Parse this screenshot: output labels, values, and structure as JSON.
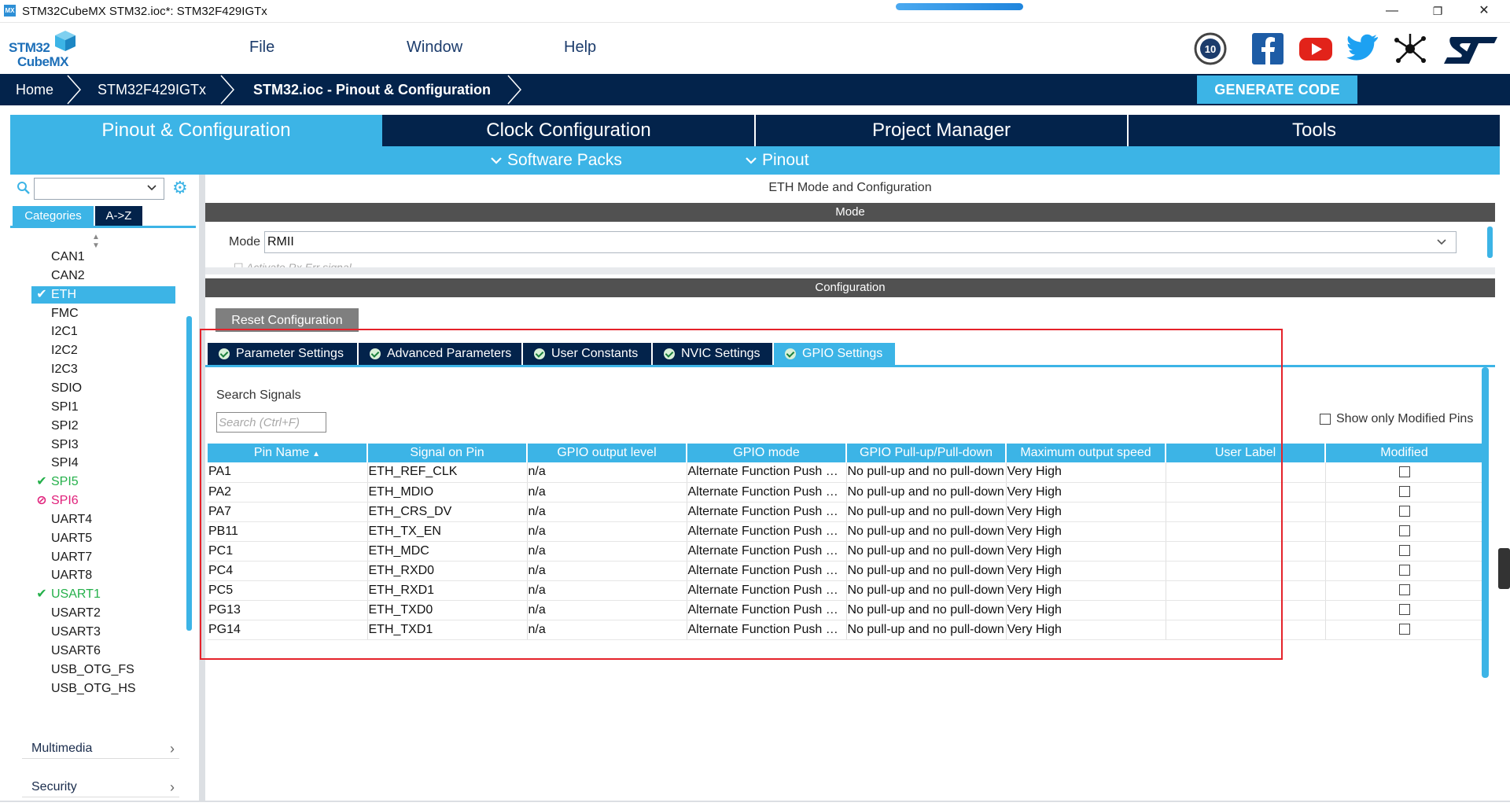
{
  "window": {
    "badge": "MX",
    "title": "STM32CubeMX STM32.ioc*: STM32F429IGTx",
    "minimize": "—",
    "maximize": "❐",
    "close": "✕"
  },
  "logo": {
    "line1": "STM32",
    "line2": "CubeMX"
  },
  "menu": {
    "file": "File",
    "window": "Window",
    "help": "Help"
  },
  "social_icons": [
    "anniversary-10-icon",
    "facebook-icon",
    "youtube-icon",
    "twitter-icon",
    "network-icon",
    "st-logo-icon"
  ],
  "breadcrumb": {
    "home": "Home",
    "device": "STM32F429IGTx",
    "current": "STM32.ioc - Pinout & Configuration",
    "generate": "GENERATE CODE"
  },
  "main_tabs": {
    "pinout": "Pinout & Configuration",
    "clock": "Clock Configuration",
    "project": "Project Manager",
    "tools": "Tools"
  },
  "sub_tabs": {
    "software_packs": "Software Packs",
    "pinout": "Pinout"
  },
  "left": {
    "tab_categories": "Categories",
    "tab_az": "A->Z",
    "items": [
      {
        "label": "CAN1",
        "state": ""
      },
      {
        "label": "CAN2",
        "state": ""
      },
      {
        "label": "ETH",
        "state": "selected"
      },
      {
        "label": "FMC",
        "state": ""
      },
      {
        "label": "I2C1",
        "state": ""
      },
      {
        "label": "I2C2",
        "state": ""
      },
      {
        "label": "I2C3",
        "state": ""
      },
      {
        "label": "SDIO",
        "state": ""
      },
      {
        "label": "SPI1",
        "state": ""
      },
      {
        "label": "SPI2",
        "state": ""
      },
      {
        "label": "SPI3",
        "state": ""
      },
      {
        "label": "SPI4",
        "state": ""
      },
      {
        "label": "SPI5",
        "state": "enabled"
      },
      {
        "label": "SPI6",
        "state": "disabled"
      },
      {
        "label": "UART4",
        "state": ""
      },
      {
        "label": "UART5",
        "state": ""
      },
      {
        "label": "UART7",
        "state": ""
      },
      {
        "label": "UART8",
        "state": ""
      },
      {
        "label": "USART1",
        "state": "enabled"
      },
      {
        "label": "USART2",
        "state": ""
      },
      {
        "label": "USART3",
        "state": ""
      },
      {
        "label": "USART6",
        "state": ""
      },
      {
        "label": "USB_OTG_FS",
        "state": ""
      },
      {
        "label": "USB_OTG_HS",
        "state": ""
      }
    ],
    "groups": {
      "multimedia": "Multimedia",
      "security": "Security"
    }
  },
  "right": {
    "header": "ETH Mode and Configuration",
    "mode_bar": "Mode",
    "mode_label": "Mode",
    "mode_value": "RMII",
    "partial_option": "Activate Rx Err signal",
    "config_bar": "Configuration",
    "reset_button": "Reset Configuration",
    "config_tabs": [
      "Parameter Settings",
      "Advanced Parameters",
      "User Constants",
      "NVIC Settings",
      "GPIO Settings"
    ],
    "active_config_tab": "GPIO Settings",
    "search_label": "Search Signals",
    "search_placeholder": "Search (Ctrl+F)",
    "show_modified": "Show only Modified Pins",
    "columns": [
      "Pin Name",
      "Signal on Pin",
      "GPIO output level",
      "GPIO mode",
      "GPIO Pull-up/Pull-down",
      "Maximum output speed",
      "User Label",
      "Modified"
    ],
    "rows": [
      {
        "pin": "PA1",
        "signal": "ETH_REF_CLK",
        "level": "n/a",
        "mode": "Alternate Function Push Pull",
        "pull": "No pull-up and no pull-down",
        "speed": "Very High",
        "label": "",
        "modified": false
      },
      {
        "pin": "PA2",
        "signal": "ETH_MDIO",
        "level": "n/a",
        "mode": "Alternate Function Push Pull",
        "pull": "No pull-up and no pull-down",
        "speed": "Very High",
        "label": "",
        "modified": false
      },
      {
        "pin": "PA7",
        "signal": "ETH_CRS_DV",
        "level": "n/a",
        "mode": "Alternate Function Push Pull",
        "pull": "No pull-up and no pull-down",
        "speed": "Very High",
        "label": "",
        "modified": false
      },
      {
        "pin": "PB11",
        "signal": "ETH_TX_EN",
        "level": "n/a",
        "mode": "Alternate Function Push Pull",
        "pull": "No pull-up and no pull-down",
        "speed": "Very High",
        "label": "",
        "modified": false
      },
      {
        "pin": "PC1",
        "signal": "ETH_MDC",
        "level": "n/a",
        "mode": "Alternate Function Push Pull",
        "pull": "No pull-up and no pull-down",
        "speed": "Very High",
        "label": "",
        "modified": false
      },
      {
        "pin": "PC4",
        "signal": "ETH_RXD0",
        "level": "n/a",
        "mode": "Alternate Function Push Pull",
        "pull": "No pull-up and no pull-down",
        "speed": "Very High",
        "label": "",
        "modified": false
      },
      {
        "pin": "PC5",
        "signal": "ETH_RXD1",
        "level": "n/a",
        "mode": "Alternate Function Push Pull",
        "pull": "No pull-up and no pull-down",
        "speed": "Very High",
        "label": "",
        "modified": false
      },
      {
        "pin": "PG13",
        "signal": "ETH_TXD0",
        "level": "n/a",
        "mode": "Alternate Function Push Pull",
        "pull": "No pull-up and no pull-down",
        "speed": "Very High",
        "label": "",
        "modified": false
      },
      {
        "pin": "PG14",
        "signal": "ETH_TXD1",
        "level": "n/a",
        "mode": "Alternate Function Push Pull",
        "pull": "No pull-up and no pull-down",
        "speed": "Very High",
        "label": "",
        "modified": false
      }
    ]
  },
  "colors": {
    "navy": "#03234b",
    "accent": "#3cb4e6",
    "enabled_green": "#24b04a",
    "disabled_pink": "#e0207a",
    "highlight_red": "#e5222a"
  }
}
